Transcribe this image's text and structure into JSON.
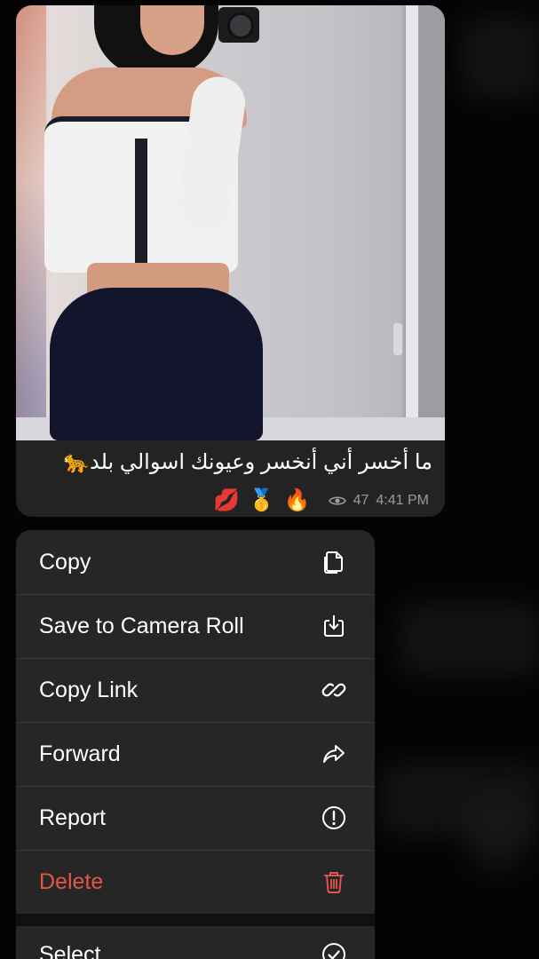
{
  "message": {
    "caption": "ما أخسر أني أنخسر وعيونك اسوالي بلد🐆",
    "reactions": [
      "💋",
      "🥇",
      "🔥"
    ],
    "views": "47",
    "time": "4:41 PM",
    "icons": {
      "views": "eye-icon"
    }
  },
  "menu": {
    "items": [
      {
        "label": "Copy",
        "icon": "copy-icon"
      },
      {
        "label": "Save to Camera Roll",
        "icon": "save-icon"
      },
      {
        "label": "Copy Link",
        "icon": "link-icon"
      },
      {
        "label": "Forward",
        "icon": "forward-icon"
      },
      {
        "label": "Report",
        "icon": "report-icon"
      },
      {
        "label": "Delete",
        "icon": "trash-icon",
        "color": "#e2554b"
      },
      {
        "label": "Select",
        "icon": "checkmark-circle-icon"
      }
    ]
  },
  "colors": {
    "background": "#040404",
    "bubble": "#232323",
    "menu": "#262626",
    "danger": "#e2554b",
    "meta": "#9a9a9a"
  }
}
